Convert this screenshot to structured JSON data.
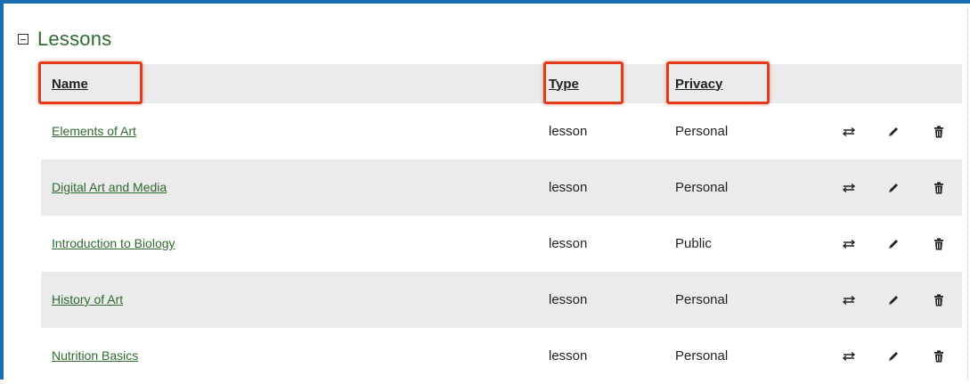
{
  "section": {
    "title": "Lessons"
  },
  "table": {
    "headers": {
      "name": "Name",
      "type": "Type",
      "privacy": "Privacy"
    },
    "rows": [
      {
        "name": "Elements of Art",
        "type": "lesson",
        "privacy": "Personal"
      },
      {
        "name": "Digital Art and Media",
        "type": "lesson",
        "privacy": "Personal"
      },
      {
        "name": "Introduction to Biology",
        "type": "lesson",
        "privacy": "Public"
      },
      {
        "name": "History of Art",
        "type": "lesson",
        "privacy": "Personal"
      },
      {
        "name": "Nutrition Basics",
        "type": "lesson",
        "privacy": "Personal"
      }
    ],
    "row_actions": [
      "move-icon",
      "edit-pencil-icon",
      "delete-trash-icon"
    ]
  },
  "colors": {
    "frame_border": "#1a6fb3",
    "title_green": "#2f6a2f",
    "row_stripe": "#ebebeb",
    "highlight_red": "#e23b1c"
  }
}
